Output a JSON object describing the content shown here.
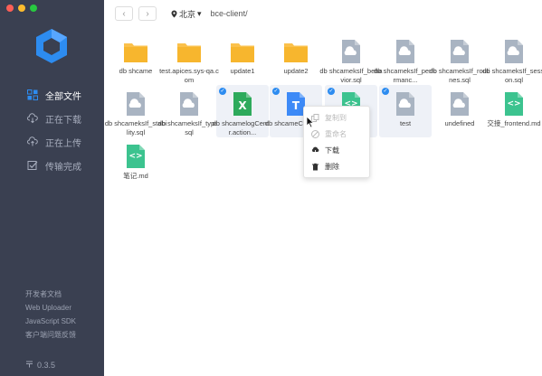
{
  "sidebar": {
    "nav": [
      {
        "label": "全部文件",
        "icon": "grid-icon",
        "active": true
      },
      {
        "label": "正在下载",
        "icon": "cloud-download-icon",
        "active": false
      },
      {
        "label": "正在上传",
        "icon": "cloud-upload-icon",
        "active": false
      },
      {
        "label": "传输完成",
        "icon": "check-box-icon",
        "active": false
      }
    ],
    "links": [
      "开发者文档",
      "Web Uploader",
      "JavaScript SDK",
      "客户端问题反馈"
    ],
    "version": "0.3.5"
  },
  "toolbar": {
    "back": "‹",
    "forward": "›",
    "region": "北京",
    "breadcrumb": "bce-client/"
  },
  "files": [
    {
      "name": "db shcame",
      "type": "folder"
    },
    {
      "name": "test.apices.sys-qa.com",
      "type": "folder"
    },
    {
      "name": "update1",
      "type": "folder"
    },
    {
      "name": "update2",
      "type": "folder"
    },
    {
      "name": "db shcameksIf_behavior.sql",
      "type": "file"
    },
    {
      "name": "db shcameksIf_performanc...",
      "type": "file"
    },
    {
      "name": "db shcameksIf_routines.sql",
      "type": "file"
    },
    {
      "name": "db shcameksIf_session.sql",
      "type": "file"
    },
    {
      "name": "db shcameksIf_stability.sql",
      "type": "file"
    },
    {
      "name": "db shcameksIf_type.sql",
      "type": "file"
    },
    {
      "name": "db shcamelogCenter.action...",
      "type": "excel",
      "badge": "X"
    },
    {
      "name": "db shcameCenter.sc",
      "type": "text",
      "badge": "T"
    },
    {
      "name": "",
      "type": "code",
      "badge": "<>"
    },
    {
      "name": "test",
      "type": "file"
    },
    {
      "name": "undefined",
      "type": "file"
    },
    {
      "name": "交接_frontend.md",
      "type": "code",
      "badge": "<>"
    },
    {
      "name": "笔记.md",
      "type": "code",
      "badge": "<>"
    }
  ],
  "context_menu": {
    "items": [
      {
        "label": "复制到",
        "icon": "copy-icon",
        "disabled": true
      },
      {
        "label": "重命名",
        "icon": "rename-icon",
        "disabled": true
      },
      {
        "label": "下载",
        "icon": "download-icon",
        "disabled": false
      },
      {
        "label": "删除",
        "icon": "trash-icon",
        "disabled": false
      }
    ]
  },
  "colors": {
    "sidebar_bg": "#3a4051",
    "folder": "#fbc14c",
    "file_gray": "#a9b4c2",
    "excel_green": "#2eaa5c",
    "text_blue": "#3d8af7",
    "code_teal": "#3cc38f",
    "accent": "#2d8cf0"
  }
}
